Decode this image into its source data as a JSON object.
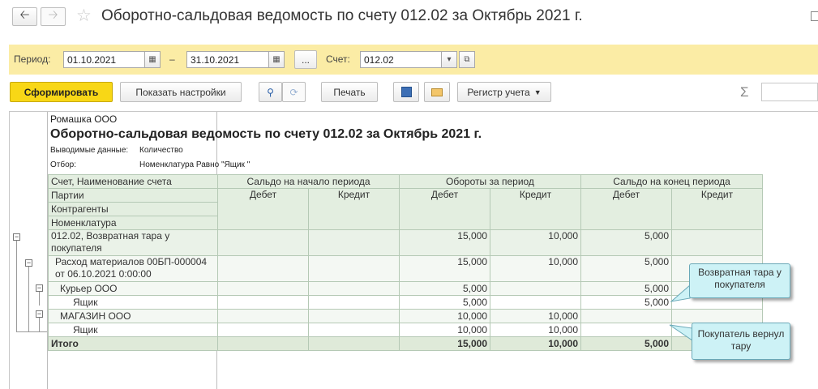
{
  "window": {
    "title": "Оборотно-сальдовая ведомость по счету 012.02 за Октябрь 2021 г.",
    "back_icon": "arrow-left-icon",
    "forward_icon": "arrow-right-icon",
    "favorite_icon": "star-icon"
  },
  "filters": {
    "period_label": "Период:",
    "date_from": "01.10.2021",
    "dash": "–",
    "date_to": "31.10.2021",
    "more_label": "...",
    "account_label": "Счет:",
    "account_value": "012.02"
  },
  "toolbar": {
    "generate_label": "Сформировать",
    "settings_label": "Показать настройки",
    "print_label": "Печать",
    "register_label": "Регистр учета",
    "sigma": "Σ"
  },
  "report": {
    "org": "Ромашка ООО",
    "title": "Оборотно-сальдовая ведомость по счету 012.02 за Октябрь 2021 г.",
    "output_label": "Выводимые данные:",
    "output_value": "Количество",
    "filter_label": "Отбор:",
    "filter_value": "Номенклатура Равно \"Ящик \"",
    "header": {
      "col1": [
        "Счет, Наименование счета",
        "Партии",
        "Контрагенты",
        "Номенклатура"
      ],
      "opening": "Сальдо на начало периода",
      "turnover": "Обороты за период",
      "closing": "Сальдо на конец периода",
      "debit": "Дебет",
      "credit": "Кредит"
    },
    "rows": [
      {
        "name": "012.02, Возвратная тара у покупателя",
        "od": "",
        "oc": "",
        "td": "15,000",
        "tc": "10,000",
        "cd": "5,000",
        "cc": ""
      },
      {
        "name": "Расход материалов 00БП-000004 от 06.10.2021 0:00:00",
        "od": "",
        "oc": "",
        "td": "15,000",
        "tc": "10,000",
        "cd": "5,000",
        "cc": ""
      },
      {
        "name": "Курьер ООО",
        "od": "",
        "oc": "",
        "td": "5,000",
        "tc": "",
        "cd": "5,000",
        "cc": ""
      },
      {
        "name": "Ящик",
        "od": "",
        "oc": "",
        "td": "5,000",
        "tc": "",
        "cd": "5,000",
        "cc": ""
      },
      {
        "name": "МАГАЗИН ООО",
        "od": "",
        "oc": "",
        "td": "10,000",
        "tc": "10,000",
        "cd": "",
        "cc": ""
      },
      {
        "name": "Ящик",
        "od": "",
        "oc": "",
        "td": "10,000",
        "tc": "10,000",
        "cd": "",
        "cc": ""
      },
      {
        "name": "Итого",
        "od": "",
        "oc": "",
        "td": "15,000",
        "tc": "10,000",
        "cd": "5,000",
        "cc": ""
      }
    ]
  },
  "callouts": {
    "first": "Возвратная тара у покупателя",
    "second": "Покупатель вернул тару"
  }
}
